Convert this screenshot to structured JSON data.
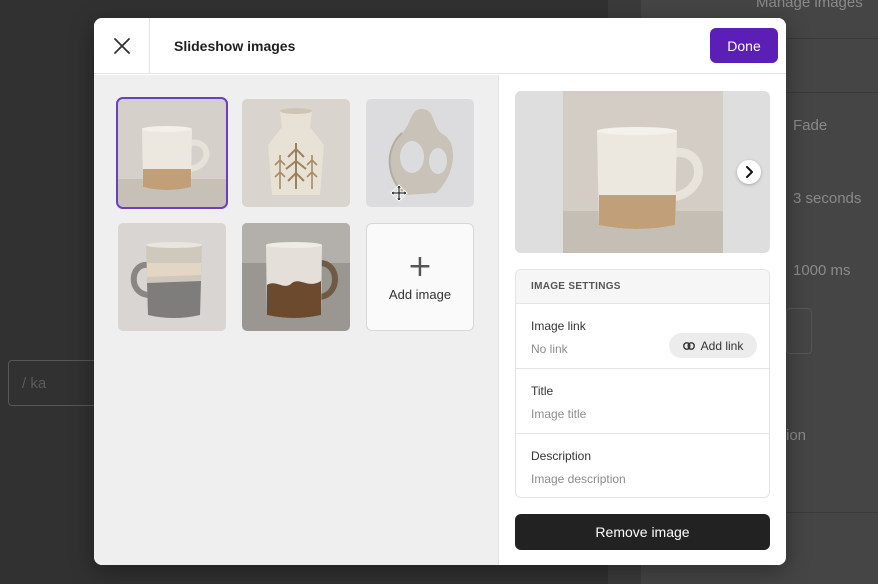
{
  "background": {
    "header_text": "Manage images",
    "transition": "Fade",
    "duration": "3 seconds",
    "speed": "1000 ms",
    "partial_text": "ion",
    "left_partial": "/ ka"
  },
  "modal": {
    "title": "Slideshow images",
    "done_label": "Done",
    "close_icon": "close-icon",
    "thumbnails": [
      {
        "name": "speckled-mug",
        "selected": true
      },
      {
        "name": "tree-vase",
        "selected": false
      },
      {
        "name": "knot-sculpture",
        "selected": false
      },
      {
        "name": "gray-striped-mug",
        "selected": false
      },
      {
        "name": "brown-drip-mug",
        "selected": false
      }
    ],
    "add_image_label": "Add image",
    "add_icon": "plus-icon",
    "preview_next_icon": "chevron-right-icon",
    "settings": {
      "heading": "IMAGE SETTINGS",
      "link_label": "Image link",
      "link_value": "No link",
      "add_link_label": "Add link",
      "title_label": "Title",
      "title_placeholder": "Image title",
      "description_label": "Description",
      "description_placeholder": "Image description"
    },
    "remove_label": "Remove image"
  },
  "colors": {
    "accent": "#5b1fb7",
    "remove": "#222222"
  }
}
